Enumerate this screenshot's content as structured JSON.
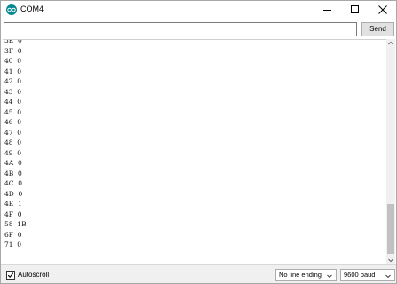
{
  "window": {
    "title": "COM4"
  },
  "toolbar": {
    "input_value": "",
    "send_label": "Send"
  },
  "output": {
    "lines": [
      "3E  0",
      "3F  0",
      "40  0",
      "41  0",
      "42  0",
      "43  0",
      "44  0",
      "45  0",
      "46  0",
      "47  0",
      "48  0",
      "49  0",
      "4A  0",
      "4B  0",
      "4C  0",
      "4D  0",
      "4E  1",
      "4F  0",
      "58  1B",
      "6F  0",
      "71  0"
    ]
  },
  "footer": {
    "autoscroll_label": "Autoscroll",
    "autoscroll_checked": true,
    "line_ending": "No line ending",
    "baud": "9600 baud"
  },
  "colors": {
    "app_icon": "#00878f",
    "scroll_thumb": "#c1c1c1",
    "footer_bg": "#f0f0f0"
  },
  "icons": [
    "arduino-logo-icon",
    "minimize-icon",
    "maximize-icon",
    "close-icon",
    "chevron-up-icon",
    "chevron-down-icon",
    "checkmark-icon"
  ]
}
